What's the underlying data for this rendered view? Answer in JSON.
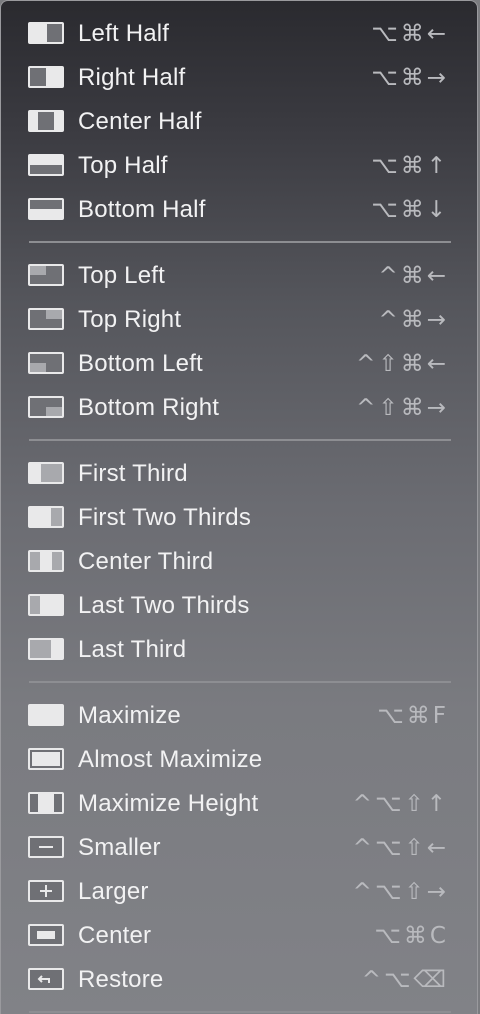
{
  "menu": {
    "items": [
      {
        "label": "Left Half",
        "shortcut": "⌥⌘←",
        "icon": "left-half-icon"
      },
      {
        "label": "Right Half",
        "shortcut": "⌥⌘→",
        "icon": "right-half-icon"
      },
      {
        "label": "Center Half",
        "shortcut": "",
        "icon": "center-half-icon"
      },
      {
        "label": "Top Half",
        "shortcut": "⌥⌘↑",
        "icon": "top-half-icon"
      },
      {
        "label": "Bottom Half",
        "shortcut": "⌥⌘↓",
        "icon": "bottom-half-icon"
      },
      {
        "label": "Top Left",
        "shortcut": "^⌘←",
        "icon": "top-left-icon"
      },
      {
        "label": "Top Right",
        "shortcut": "^⌘→",
        "icon": "top-right-icon"
      },
      {
        "label": "Bottom Left",
        "shortcut": "^⇧⌘←",
        "icon": "bottom-left-icon"
      },
      {
        "label": "Bottom Right",
        "shortcut": "^⇧⌘→",
        "icon": "bottom-right-icon"
      },
      {
        "label": "First Third",
        "shortcut": "",
        "icon": "first-third-icon"
      },
      {
        "label": "First Two Thirds",
        "shortcut": "",
        "icon": "first-two-thirds-icon"
      },
      {
        "label": "Center Third",
        "shortcut": "",
        "icon": "center-third-icon"
      },
      {
        "label": "Last Two Thirds",
        "shortcut": "",
        "icon": "last-two-thirds-icon"
      },
      {
        "label": "Last Third",
        "shortcut": "",
        "icon": "last-third-icon"
      },
      {
        "label": "Maximize",
        "shortcut": "⌥⌘F",
        "icon": "maximize-icon"
      },
      {
        "label": "Almost Maximize",
        "shortcut": "",
        "icon": "almost-maximize-icon"
      },
      {
        "label": "Maximize Height",
        "shortcut": "^⌥⇧↑",
        "icon": "maximize-height-icon"
      },
      {
        "label": "Smaller",
        "shortcut": "^⌥⇧←",
        "icon": "smaller-icon"
      },
      {
        "label": "Larger",
        "shortcut": "^⌥⇧→",
        "icon": "larger-icon"
      },
      {
        "label": "Center",
        "shortcut": "⌥⌘C",
        "icon": "center-icon"
      },
      {
        "label": "Restore",
        "shortcut": "^⌥⌫",
        "icon": "restore-icon"
      }
    ]
  }
}
